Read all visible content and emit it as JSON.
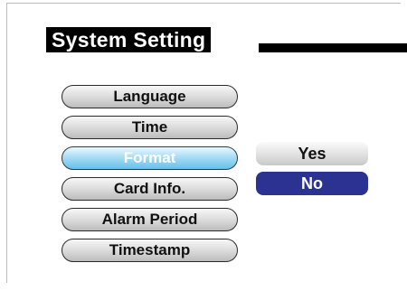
{
  "title": "System Setting",
  "menu": {
    "items": [
      {
        "label": "Language"
      },
      {
        "label": "Time"
      },
      {
        "label": "Format",
        "selected": true
      },
      {
        "label": "Card Info."
      },
      {
        "label": "Alarm Period"
      },
      {
        "label": "Timestamp"
      }
    ]
  },
  "options": {
    "yes_label": "Yes",
    "no_label": "No",
    "highlighted": "No"
  },
  "colors": {
    "selected_menu": "#7fcbee",
    "highlight_option": "#2b3292",
    "title_bg": "#000000"
  }
}
